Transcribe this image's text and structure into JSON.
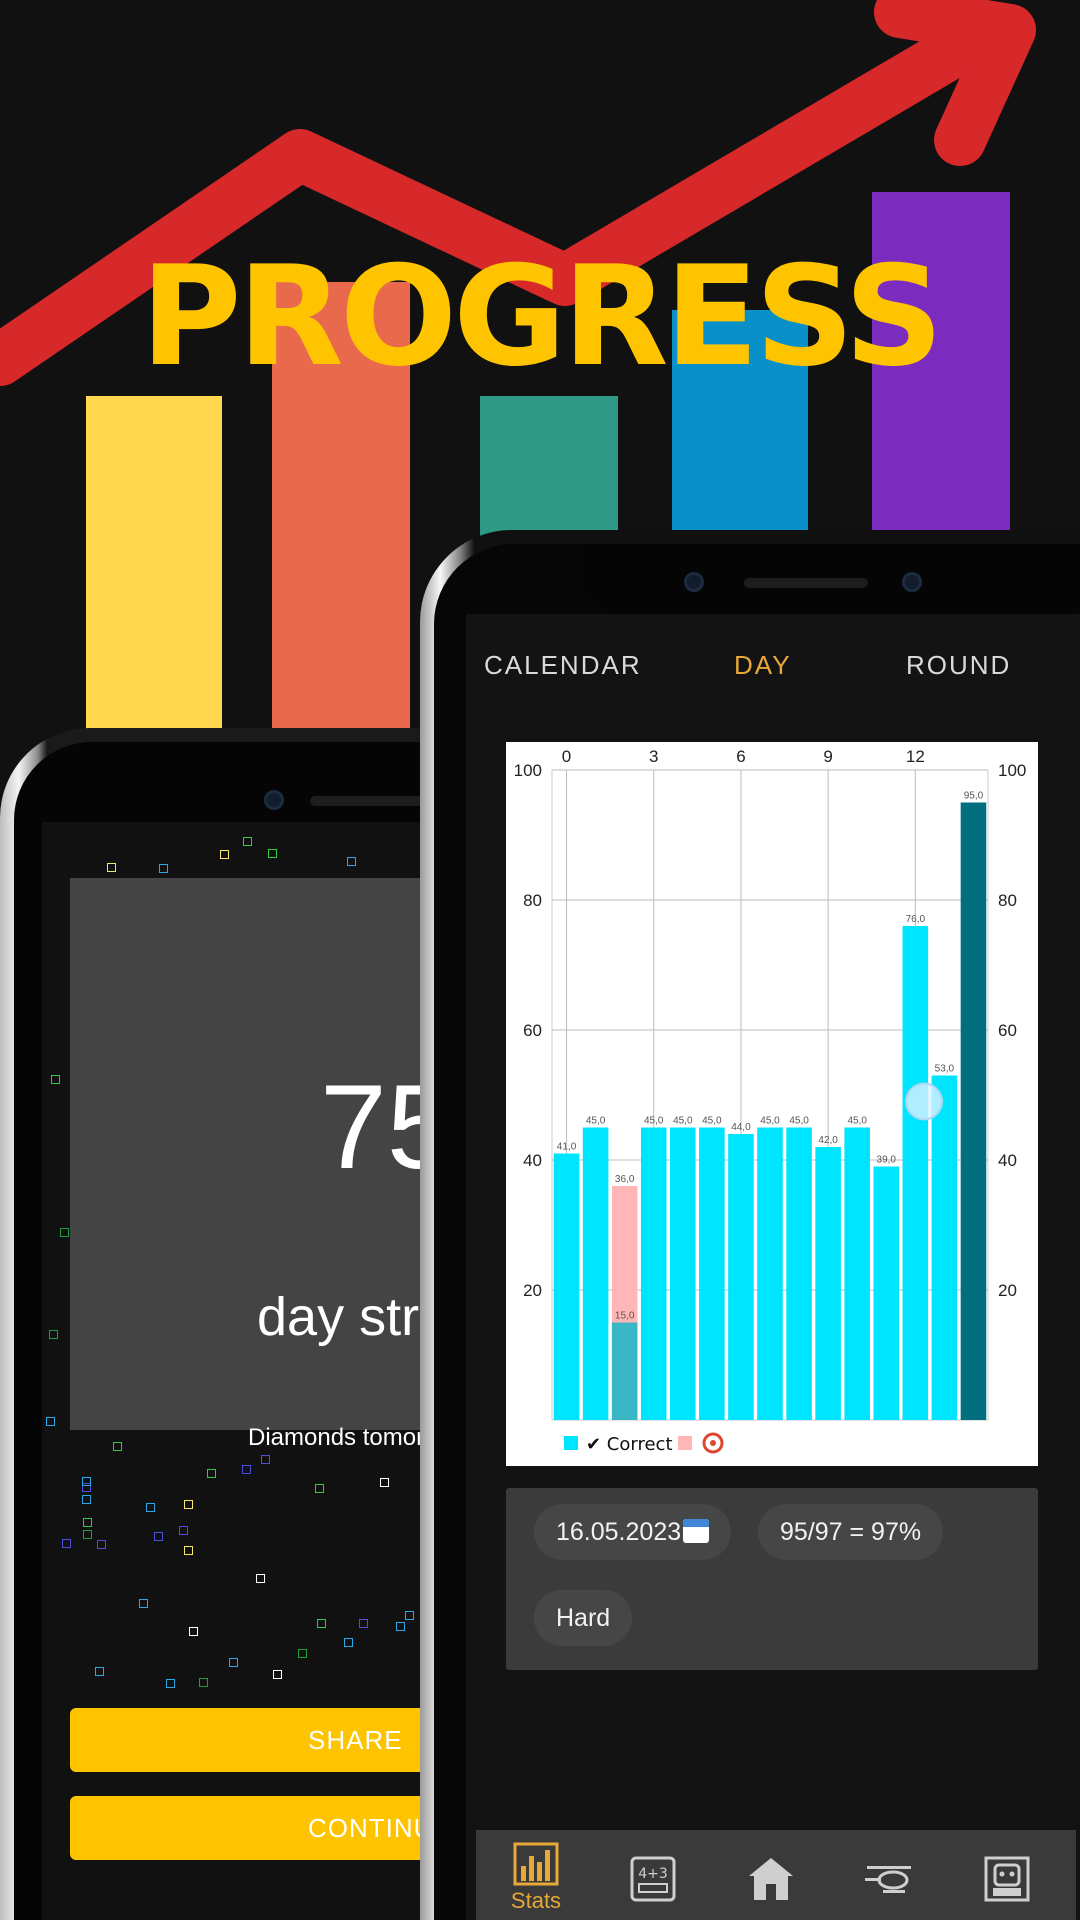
{
  "promo": {
    "headline": "PROGRESS",
    "colors": {
      "headline": "#FFC400",
      "arrow": "#D7282A",
      "bars": [
        "#FFD84D",
        "#E8694C",
        "#2E9A86",
        "#0A90C8",
        "#7B2CBF"
      ]
    }
  },
  "streak_screen": {
    "streak_value": "75",
    "streak_label": "day stre",
    "subtitle": "Diamonds tomorro",
    "share_button": "SHARE",
    "continue_button": "CONTINUE"
  },
  "stats_screen": {
    "tabs": [
      {
        "label": "CALENDAR",
        "active": false
      },
      {
        "label": "DAY",
        "active": true
      },
      {
        "label": "ROUND",
        "active": false
      }
    ],
    "info": {
      "date": "16.05.2023",
      "score": "95/97 = 97%",
      "difficulty": "Hard"
    },
    "legend": {
      "correct_label": "✔ Correct"
    },
    "bottom_nav": [
      {
        "icon": "bar-chart-icon",
        "label": "Stats",
        "active": true
      },
      {
        "icon": "math-keypad-icon",
        "label": "",
        "active": false
      },
      {
        "icon": "home-icon",
        "label": "",
        "active": false
      },
      {
        "icon": "helicopter-icon",
        "label": "",
        "active": false
      },
      {
        "icon": "profile-robot-icon",
        "label": "",
        "active": false
      }
    ]
  },
  "chart_data": {
    "type": "bar",
    "x_top_ticks": [
      "0",
      "3",
      "6",
      "9",
      "12"
    ],
    "y_ticks": [
      20,
      40,
      60,
      80,
      100
    ],
    "ylim": [
      0,
      100
    ],
    "xlim": [
      0,
      15
    ],
    "grid": true,
    "legend_position": "bottom-left",
    "series": [
      {
        "name": "Correct",
        "color": "#00E5FF",
        "x": [
          0,
          1,
          3,
          4,
          5,
          6,
          7,
          8,
          9,
          10,
          11,
          12,
          13
        ],
        "values": [
          41.0,
          45.0,
          45.0,
          45.0,
          45.0,
          44.0,
          45.0,
          45.0,
          42.0,
          45.0,
          39.0,
          76.0,
          53.0
        ]
      },
      {
        "color": "#FFB6B6",
        "x": [
          2
        ],
        "values": [
          36.0
        ]
      },
      {
        "color": "#3AB7C7",
        "x": [
          2
        ],
        "values": [
          15.0
        ]
      },
      {
        "color": "#006E7F",
        "x": [
          14
        ],
        "values": [
          95.0
        ]
      }
    ]
  }
}
